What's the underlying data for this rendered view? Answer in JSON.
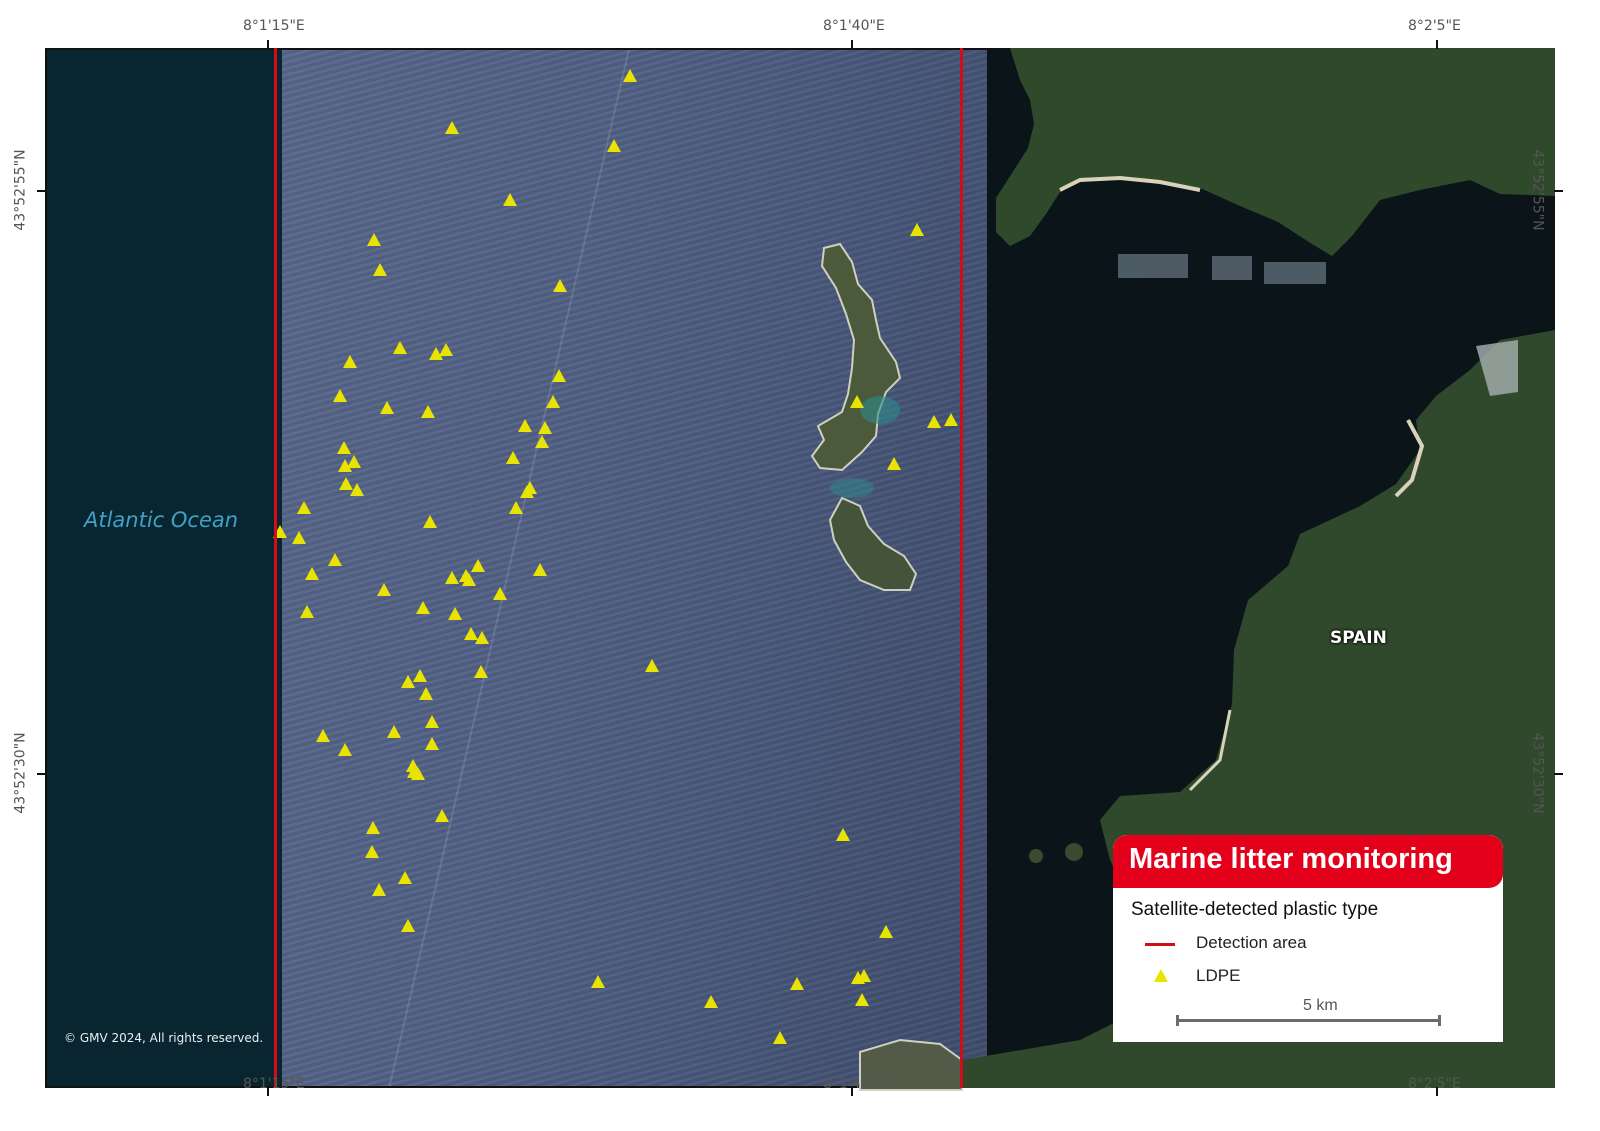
{
  "map": {
    "ocean_label": "Atlantic Ocean",
    "country_label": "SPAIN",
    "copyright": "© GMV 2024, All rights reserved."
  },
  "axes": {
    "top_ticks": [
      "8°1'15\"E",
      "8°1'40\"E",
      "8°2'5\"E"
    ],
    "bottom_ticks": [
      "8°1'15\"E",
      "8°1'40\"E",
      "8°2'5\"E"
    ],
    "left_ticks": [
      "43°52'55\"N",
      "43°52'30\"N"
    ],
    "right_ticks": [
      "43°52'55\"N",
      "43°52'30\"N"
    ]
  },
  "legend": {
    "title": "Marine litter monitoring",
    "subtitle": "Satellite-detected plastic type",
    "items": [
      {
        "label": "Detection area",
        "symbol": "red-line",
        "color": "#d10d1a"
      },
      {
        "label": "LDPE",
        "symbol": "yellow-triangle",
        "color": "#e8e400"
      }
    ],
    "scale_label": "5 km"
  },
  "colors": {
    "brand_red": "#e4001b",
    "detection_line": "#d10d1a",
    "marker": "#e8e400",
    "ocean_dark": "#092630",
    "water_label": "#3fa0c8"
  }
}
